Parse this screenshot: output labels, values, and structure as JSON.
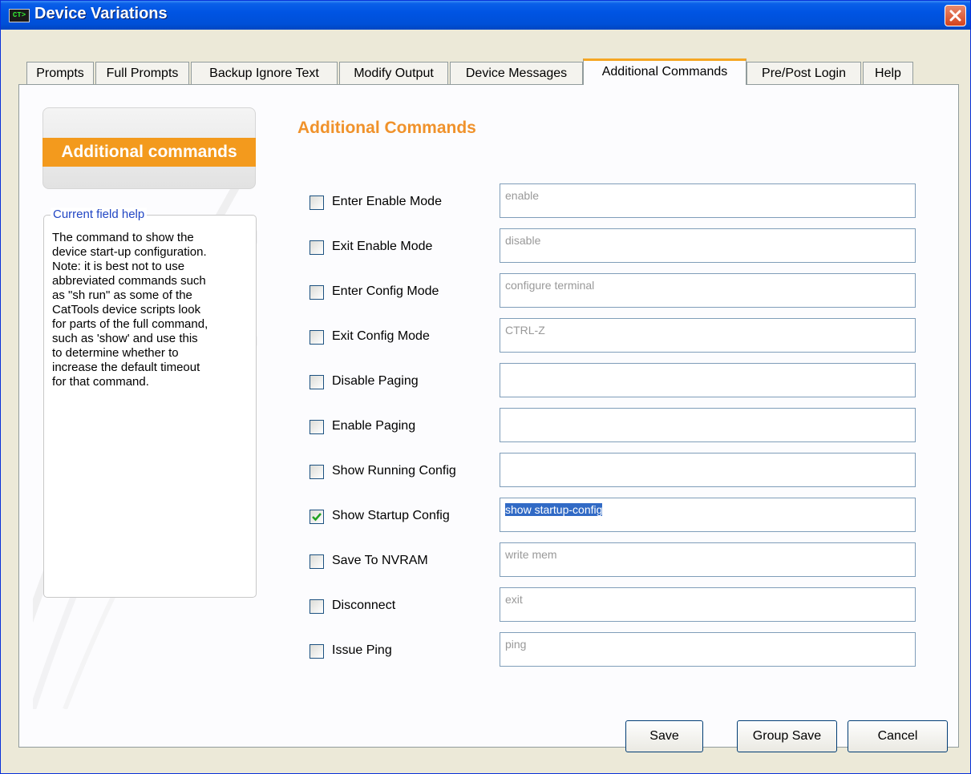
{
  "window": {
    "title": "Device Variations",
    "icon_text": "CT>",
    "accent": "#f39a1d"
  },
  "tabs": [
    {
      "label": "Prompts"
    },
    {
      "label": "Full Prompts"
    },
    {
      "label": "Backup Ignore Text"
    },
    {
      "label": "Modify Output"
    },
    {
      "label": "Device Messages"
    },
    {
      "label": "Additional Commands",
      "active": true
    },
    {
      "label": "Pre/Post Login"
    },
    {
      "label": "Help"
    }
  ],
  "badge": {
    "label": "Additional commands"
  },
  "help": {
    "legend": "Current field help",
    "lines": [
      "The command to show the",
      "device start-up configuration.",
      "Note: it is best not to use",
      "abbreviated commands such",
      "as \"sh run\" as some of the",
      "CatTools device scripts look",
      "for parts of the full command,",
      "such as 'show' and use this",
      "to determine whether to",
      "increase the default timeout",
      "for that command."
    ]
  },
  "heading": "Additional Commands",
  "commands": [
    {
      "label": "Enter Enable Mode",
      "value": "enable",
      "checked": false
    },
    {
      "label": "Exit Enable Mode",
      "value": "disable",
      "checked": false
    },
    {
      "label": "Enter Config Mode",
      "value": "configure terminal",
      "checked": false
    },
    {
      "label": "Exit Config Mode",
      "value": "CTRL-Z",
      "checked": false
    },
    {
      "label": "Disable Paging",
      "value": "",
      "checked": false
    },
    {
      "label": "Enable Paging",
      "value": "",
      "checked": false
    },
    {
      "label": "Show Running Config",
      "value": "",
      "checked": false
    },
    {
      "label": "Show Startup Config",
      "value": "show startup-config",
      "checked": true
    },
    {
      "label": "Save To NVRAM",
      "value": "write mem",
      "checked": false
    },
    {
      "label": "Disconnect",
      "value": "exit",
      "checked": false
    },
    {
      "label": "Issue Ping",
      "value": "ping",
      "checked": false
    }
  ],
  "buttons": {
    "save": "Save",
    "group_save": "Group Save",
    "cancel": "Cancel"
  }
}
